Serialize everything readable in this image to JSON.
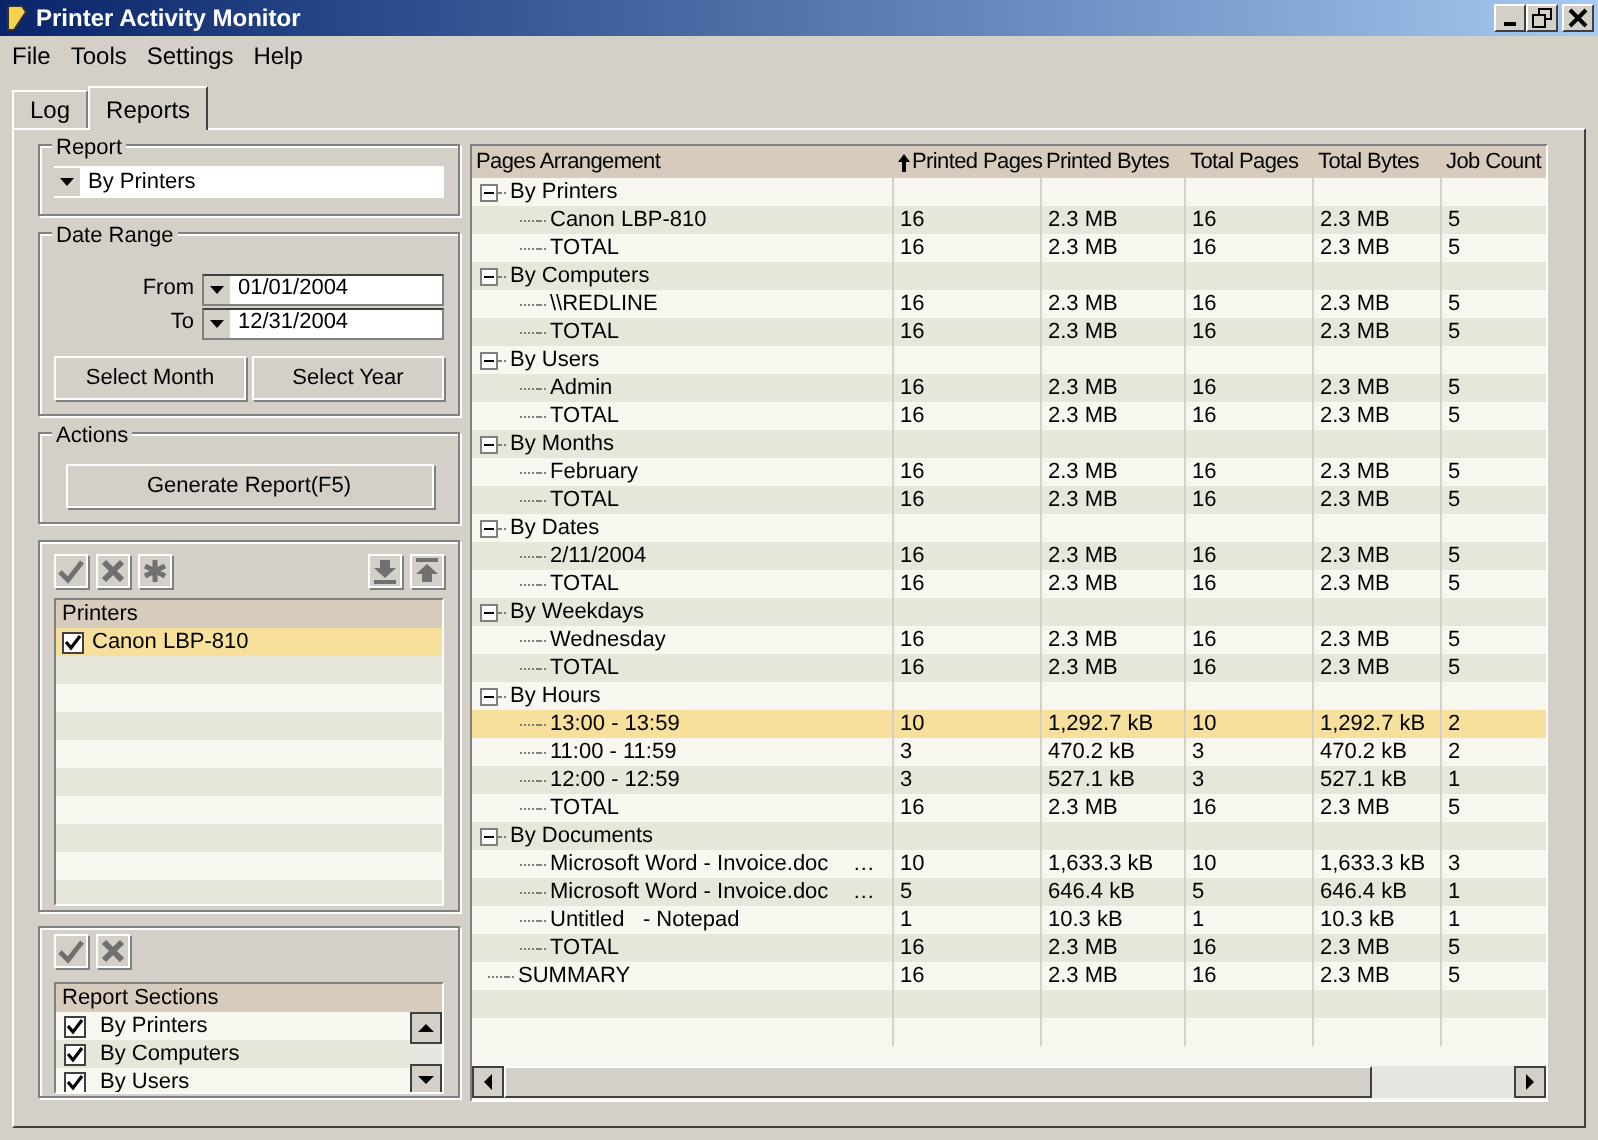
{
  "window": {
    "title": "Printer Activity Monitor"
  },
  "menu": [
    "File",
    "Tools",
    "Settings",
    "Help"
  ],
  "tabs": [
    {
      "label": "Log",
      "selected": false
    },
    {
      "label": "Reports",
      "selected": true
    }
  ],
  "report": {
    "title": "Report",
    "value": "By Printers"
  },
  "date_range": {
    "title": "Date Range",
    "from_label": "From",
    "from": "01/01/2004",
    "to_label": "To",
    "to": "12/31/2004",
    "buttons": [
      "Select Month",
      "Select Year"
    ]
  },
  "actions": {
    "title": "Actions",
    "button": "Generate Report(F5)"
  },
  "printers": {
    "header": "Printers",
    "items": [
      {
        "label": "Canon LBP-810",
        "checked": true,
        "selected": true
      }
    ]
  },
  "sections": {
    "header": "Report Sections",
    "items": [
      {
        "label": "By Printers",
        "checked": true
      },
      {
        "label": "By Computers",
        "checked": true
      },
      {
        "label": "By Users",
        "checked": true
      }
    ]
  },
  "table": {
    "columns": [
      {
        "label": "Pages Arrangement",
        "sorted": false
      },
      {
        "label": "Printed Pages",
        "sorted": true
      },
      {
        "label": "Printed Bytes",
        "sorted": false
      },
      {
        "label": "Total Pages",
        "sorted": false
      },
      {
        "label": "Total Bytes",
        "sorted": false
      },
      {
        "label": "Job Count",
        "sorted": false
      }
    ],
    "rows": [
      {
        "label": "By Printers",
        "expanded": true,
        "children": [
          {
            "label": "Canon LBP-810",
            "selected": false,
            "values": [
              "16",
              "2.3 MB",
              "16",
              "2.3 MB",
              "5"
            ]
          },
          {
            "label": "TOTAL",
            "selected": false,
            "values": [
              "16",
              "2.3 MB",
              "16",
              "2.3 MB",
              "5"
            ]
          }
        ]
      },
      {
        "label": "By Computers",
        "expanded": true,
        "children": [
          {
            "label": "\\\\REDLINE",
            "selected": false,
            "values": [
              "16",
              "2.3 MB",
              "16",
              "2.3 MB",
              "5"
            ]
          },
          {
            "label": "TOTAL",
            "selected": false,
            "values": [
              "16",
              "2.3 MB",
              "16",
              "2.3 MB",
              "5"
            ]
          }
        ]
      },
      {
        "label": "By Users",
        "expanded": true,
        "children": [
          {
            "label": "Admin",
            "selected": false,
            "values": [
              "16",
              "2.3 MB",
              "16",
              "2.3 MB",
              "5"
            ]
          },
          {
            "label": "TOTAL",
            "selected": false,
            "values": [
              "16",
              "2.3 MB",
              "16",
              "2.3 MB",
              "5"
            ]
          }
        ]
      },
      {
        "label": "By Months",
        "expanded": true,
        "children": [
          {
            "label": "February",
            "selected": false,
            "values": [
              "16",
              "2.3 MB",
              "16",
              "2.3 MB",
              "5"
            ]
          },
          {
            "label": "TOTAL",
            "selected": false,
            "values": [
              "16",
              "2.3 MB",
              "16",
              "2.3 MB",
              "5"
            ]
          }
        ]
      },
      {
        "label": "By Dates",
        "expanded": true,
        "children": [
          {
            "label": "2/11/2004",
            "selected": false,
            "values": [
              "16",
              "2.3 MB",
              "16",
              "2.3 MB",
              "5"
            ]
          },
          {
            "label": "TOTAL",
            "selected": false,
            "values": [
              "16",
              "2.3 MB",
              "16",
              "2.3 MB",
              "5"
            ]
          }
        ]
      },
      {
        "label": "By Weekdays",
        "expanded": true,
        "children": [
          {
            "label": "Wednesday",
            "selected": false,
            "values": [
              "16",
              "2.3 MB",
              "16",
              "2.3 MB",
              "5"
            ]
          },
          {
            "label": "TOTAL",
            "selected": false,
            "values": [
              "16",
              "2.3 MB",
              "16",
              "2.3 MB",
              "5"
            ]
          }
        ]
      },
      {
        "label": "By Hours",
        "expanded": true,
        "children": [
          {
            "label": "13:00 - 13:59",
            "selected": true,
            "values": [
              "10",
              "1,292.7 kB",
              "10",
              "1,292.7 kB",
              "2"
            ]
          },
          {
            "label": "11:00 - 11:59",
            "selected": false,
            "values": [
              "3",
              "470.2 kB",
              "3",
              "470.2 kB",
              "2"
            ]
          },
          {
            "label": "12:00 - 12:59",
            "selected": false,
            "values": [
              "3",
              "527.1 kB",
              "3",
              "527.1 kB",
              "1"
            ]
          },
          {
            "label": "TOTAL",
            "selected": false,
            "values": [
              "16",
              "2.3 MB",
              "16",
              "2.3 MB",
              "5"
            ]
          }
        ]
      },
      {
        "label": "By Documents",
        "expanded": true,
        "children": [
          {
            "label": "Microsoft Word - Invoice.doc    …",
            "selected": false,
            "values": [
              "10",
              "1,633.3 kB",
              "10",
              "1,633.3 kB",
              "3"
            ]
          },
          {
            "label": "Microsoft Word - Invoice.doc    …",
            "selected": false,
            "values": [
              "5",
              "646.4 kB",
              "5",
              "646.4 kB",
              "1"
            ]
          },
          {
            "label": "Untitled   - Notepad",
            "selected": false,
            "values": [
              "1",
              "10.3 kB",
              "1",
              "10.3 kB",
              "1"
            ]
          },
          {
            "label": "TOTAL",
            "selected": false,
            "values": [
              "16",
              "2.3 MB",
              "16",
              "2.3 MB",
              "5"
            ]
          }
        ]
      },
      {
        "label": "SUMMARY",
        "selected": false,
        "values": [
          "16",
          "2.3 MB",
          "16",
          "2.3 MB",
          "5"
        ]
      }
    ]
  }
}
